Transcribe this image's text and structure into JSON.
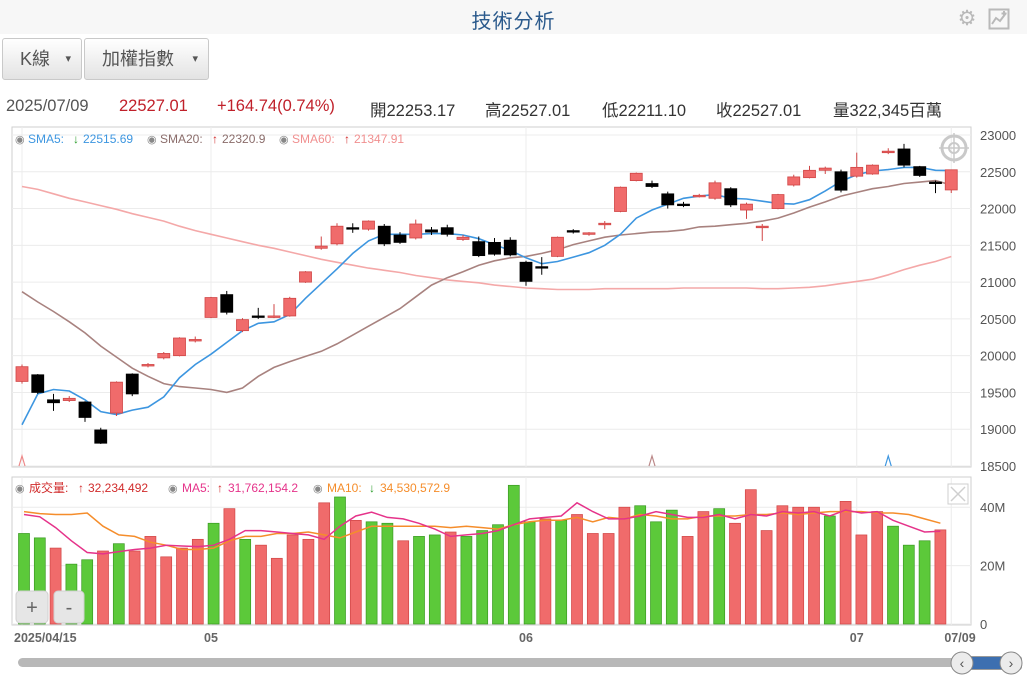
{
  "header": {
    "title": "技術分析",
    "settings_icon": "gear-icon",
    "chart_icon": "chart-icon"
  },
  "toolbar": {
    "type_label": "K線",
    "index_label": "加權指數"
  },
  "info": {
    "date": "2025/07/09",
    "close_price": "22527.01",
    "change": "+164.74(0.74%)",
    "open": "開22253.17",
    "high": "高22527.01",
    "low": "低22211.10",
    "close": "收22527.01",
    "volume": "量322,345百萬"
  },
  "legend_price": {
    "sma5_label": "SMA5:",
    "sma5_value": "22515.69",
    "sma5_arrow": "↓",
    "sma20_label": "SMA20:",
    "sma20_value": "22320.9",
    "sma20_arrow": "↑",
    "sma60_label": "SMA60:",
    "sma60_value": "21347.91",
    "sma60_arrow": "↑"
  },
  "legend_volume": {
    "vol_label": "成交量:",
    "vol_value": "32,234,492",
    "vol_arrow": "↑",
    "ma5_label": "MA5:",
    "ma5_value": "31,762,154.2",
    "ma5_arrow": "↑",
    "ma10_label": "MA10:",
    "ma10_value": "34,530,572.9",
    "ma10_arrow": "↓"
  },
  "zoom": {
    "in_label": "+",
    "out_label": "-"
  },
  "colors": {
    "up": "#f06b6b",
    "down": "#000000",
    "sma5": "#3d96e0",
    "sma20": "#a8827f",
    "sma60": "#f4a8a8",
    "vol_up": "#f06b6b",
    "vol_down": "#5cc93a",
    "ma5": "#e5338a",
    "ma10": "#f58d2b",
    "info_red": "#c0202a",
    "title": "#2b5a8c"
  },
  "chart_data": [
    {
      "type": "candlestick",
      "ylim": [
        18500,
        23000
      ],
      "y_ticks": [
        "23000",
        "22500",
        "22000",
        "21500",
        "21000",
        "20500",
        "20000",
        "19500",
        "19000",
        "18500"
      ],
      "x_labels": [
        "2025/04/15",
        "05",
        "06",
        "07",
        "07/09"
      ],
      "candles": [
        {
          "o": 19650,
          "h": 19880,
          "l": 19620,
          "c": 19850
        },
        {
          "o": 19740,
          "h": 19750,
          "l": 19480,
          "c": 19500
        },
        {
          "o": 19400,
          "h": 19480,
          "l": 19250,
          "c": 19360
        },
        {
          "o": 19390,
          "h": 19450,
          "l": 19370,
          "c": 19420
        },
        {
          "o": 19370,
          "h": 19380,
          "l": 19100,
          "c": 19160
        },
        {
          "o": 18990,
          "h": 19020,
          "l": 18800,
          "c": 18810
        },
        {
          "o": 19220,
          "h": 19650,
          "l": 19180,
          "c": 19640
        },
        {
          "o": 19750,
          "h": 19760,
          "l": 19450,
          "c": 19480
        },
        {
          "o": 19860,
          "h": 19900,
          "l": 19840,
          "c": 19880
        },
        {
          "o": 19970,
          "h": 20050,
          "l": 19950,
          "c": 20030
        },
        {
          "o": 20000,
          "h": 20250,
          "l": 19990,
          "c": 20240
        },
        {
          "o": 20200,
          "h": 20260,
          "l": 20180,
          "c": 20220
        },
        {
          "o": 20520,
          "h": 20800,
          "l": 20510,
          "c": 20790
        },
        {
          "o": 20830,
          "h": 20880,
          "l": 20560,
          "c": 20590
        },
        {
          "o": 20340,
          "h": 20510,
          "l": 20320,
          "c": 20490
        },
        {
          "o": 20540,
          "h": 20650,
          "l": 20500,
          "c": 20520
        },
        {
          "o": 20530,
          "h": 20700,
          "l": 20510,
          "c": 20540
        },
        {
          "o": 20540,
          "h": 20800,
          "l": 20530,
          "c": 20780
        },
        {
          "o": 21000,
          "h": 21150,
          "l": 20990,
          "c": 21140
        },
        {
          "o": 21460,
          "h": 21620,
          "l": 21440,
          "c": 21490
        },
        {
          "o": 21520,
          "h": 21800,
          "l": 21500,
          "c": 21760
        },
        {
          "o": 21740,
          "h": 21800,
          "l": 21670,
          "c": 21730
        },
        {
          "o": 21720,
          "h": 21840,
          "l": 21700,
          "c": 21830
        },
        {
          "o": 21760,
          "h": 21790,
          "l": 21490,
          "c": 21520
        },
        {
          "o": 21640,
          "h": 21680,
          "l": 21520,
          "c": 21540
        },
        {
          "o": 21600,
          "h": 21850,
          "l": 21580,
          "c": 21790
        },
        {
          "o": 21710,
          "h": 21750,
          "l": 21640,
          "c": 21680
        },
        {
          "o": 21740,
          "h": 21780,
          "l": 21620,
          "c": 21650
        },
        {
          "o": 21580,
          "h": 21640,
          "l": 21560,
          "c": 21610
        },
        {
          "o": 21550,
          "h": 21620,
          "l": 21340,
          "c": 21360
        },
        {
          "o": 21540,
          "h": 21600,
          "l": 21360,
          "c": 21380
        },
        {
          "o": 21570,
          "h": 21610,
          "l": 21350,
          "c": 21370
        },
        {
          "o": 21270,
          "h": 21290,
          "l": 20950,
          "c": 21010
        },
        {
          "o": 21210,
          "h": 21340,
          "l": 21100,
          "c": 21200
        },
        {
          "o": 21350,
          "h": 21620,
          "l": 21340,
          "c": 21610
        },
        {
          "o": 21700,
          "h": 21720,
          "l": 21660,
          "c": 21680
        },
        {
          "o": 21650,
          "h": 21680,
          "l": 21630,
          "c": 21670
        },
        {
          "o": 21790,
          "h": 21830,
          "l": 21720,
          "c": 21800
        },
        {
          "o": 21960,
          "h": 22300,
          "l": 21950,
          "c": 22290
        },
        {
          "o": 22380,
          "h": 22490,
          "l": 22370,
          "c": 22480
        },
        {
          "o": 22340,
          "h": 22380,
          "l": 22280,
          "c": 22300
        },
        {
          "o": 22200,
          "h": 22230,
          "l": 22000,
          "c": 22050
        },
        {
          "o": 22060,
          "h": 22090,
          "l": 22020,
          "c": 22050
        },
        {
          "o": 22160,
          "h": 22200,
          "l": 22150,
          "c": 22180
        },
        {
          "o": 22140,
          "h": 22380,
          "l": 22120,
          "c": 22350
        },
        {
          "o": 22270,
          "h": 22290,
          "l": 22020,
          "c": 22050
        },
        {
          "o": 21980,
          "h": 22080,
          "l": 21860,
          "c": 22060
        },
        {
          "o": 21740,
          "h": 21790,
          "l": 21560,
          "c": 21760
        },
        {
          "o": 22000,
          "h": 22200,
          "l": 21990,
          "c": 22190
        },
        {
          "o": 22320,
          "h": 22460,
          "l": 22300,
          "c": 22430
        },
        {
          "o": 22420,
          "h": 22580,
          "l": 22410,
          "c": 22520
        },
        {
          "o": 22520,
          "h": 22570,
          "l": 22470,
          "c": 22550
        },
        {
          "o": 22500,
          "h": 22530,
          "l": 22220,
          "c": 22250
        },
        {
          "o": 22440,
          "h": 22760,
          "l": 22420,
          "c": 22560
        },
        {
          "o": 22470,
          "h": 22600,
          "l": 22460,
          "c": 22590
        },
        {
          "o": 22760,
          "h": 22820,
          "l": 22740,
          "c": 22780
        },
        {
          "o": 22810,
          "h": 22880,
          "l": 22560,
          "c": 22590
        },
        {
          "o": 22570,
          "h": 22580,
          "l": 22430,
          "c": 22450
        },
        {
          "o": 22360,
          "h": 22380,
          "l": 22210,
          "c": 22350
        },
        {
          "o": 22253.17,
          "h": 22527.01,
          "l": 22211.1,
          "c": 22527.01
        }
      ],
      "sma5": [
        19060,
        19480,
        19540,
        19520,
        19400,
        19240,
        19200,
        19260,
        19300,
        19440,
        19700,
        19880,
        20020,
        20180,
        20340,
        20440,
        20460,
        20560,
        20780,
        20980,
        21180,
        21390,
        21560,
        21650,
        21650,
        21650,
        21660,
        21660,
        21640,
        21590,
        21510,
        21430,
        21330,
        21250,
        21280,
        21340,
        21400,
        21500,
        21650,
        21870,
        21980,
        22060,
        22140,
        22170,
        22190,
        22140,
        22130,
        22100,
        22070,
        22060,
        22120,
        22240,
        22370,
        22460,
        22510,
        22530,
        22560,
        22560,
        22520,
        22515.69
      ],
      "sma20": [
        20870,
        20730,
        20600,
        20460,
        20310,
        20130,
        19980,
        19830,
        19720,
        19620,
        19580,
        19560,
        19540,
        19500,
        19560,
        19720,
        19840,
        19920,
        19990,
        20060,
        20160,
        20280,
        20400,
        20520,
        20640,
        20800,
        20960,
        21060,
        21140,
        21230,
        21290,
        21330,
        21350,
        21390,
        21440,
        21510,
        21560,
        21610,
        21640,
        21660,
        21680,
        21690,
        21710,
        21750,
        21760,
        21780,
        21800,
        21830,
        21870,
        21940,
        22020,
        22090,
        22170,
        22220,
        22270,
        22300,
        22340,
        22360,
        22380,
        22320.9
      ],
      "sma60": [
        22300,
        22260,
        22200,
        22140,
        22090,
        22040,
        21990,
        21930,
        21880,
        21830,
        21760,
        21700,
        21650,
        21600,
        21550,
        21500,
        21460,
        21410,
        21360,
        21310,
        21270,
        21230,
        21190,
        21160,
        21130,
        21090,
        21060,
        21030,
        21010,
        20990,
        20960,
        20940,
        20920,
        20910,
        20900,
        20900,
        20900,
        20910,
        20910,
        20910,
        20910,
        20910,
        20920,
        20920,
        20920,
        20920,
        20920,
        20910,
        20910,
        20920,
        20930,
        20950,
        20980,
        21010,
        21040,
        21100,
        21170,
        21230,
        21280,
        21347.91
      ]
    },
    {
      "type": "bar",
      "ylim": [
        0,
        50000000
      ],
      "y_ticks": [
        "40M",
        "20M",
        "0"
      ],
      "volume": [
        31000000,
        29500000,
        26000000,
        20500000,
        22000000,
        25000000,
        27500000,
        25000000,
        30000000,
        23000000,
        26000000,
        29000000,
        34500000,
        39500000,
        29000000,
        27000000,
        22500000,
        30500000,
        29000000,
        41500000,
        43500000,
        35500000,
        35000000,
        34500000,
        28500000,
        30000000,
        30500000,
        31500000,
        30000000,
        32000000,
        34000000,
        47500000,
        35000000,
        36000000,
        35500000,
        37500000,
        31000000,
        31000000,
        40000000,
        40500000,
        35000000,
        39000000,
        30000000,
        38500000,
        39500000,
        34500000,
        46000000,
        32000000,
        40500000,
        40000000,
        40000000,
        37000000,
        42000000,
        30500000,
        38500000,
        33500000,
        27000000,
        28500000,
        32234492
      ],
      "ma5": [
        37500,
        36700,
        33000,
        28500,
        24500,
        24000,
        24800,
        25500,
        26000,
        27000,
        26700,
        26500,
        27000,
        29000,
        32000,
        32000,
        31500,
        31000,
        30500,
        29000,
        33500,
        37000,
        38300,
        36500,
        36000,
        34500,
        32500,
        30000,
        30500,
        31000,
        32000,
        34000,
        36000,
        36500,
        37000,
        41500,
        38500,
        36000,
        36000,
        37000,
        38500,
        37500,
        36500,
        36500,
        37500,
        36000,
        37500,
        37000,
        38500,
        38000,
        38500,
        37000,
        39000,
        38000,
        38500,
        35500,
        33500,
        31500,
        31762154.2
      ],
      "ma10": [
        38500,
        37800,
        37500,
        37500,
        38000,
        33500,
        30500,
        30000,
        28000,
        27000,
        25500,
        25500,
        26000,
        28500,
        30000,
        30000,
        31000,
        31000,
        31500,
        30500,
        29500,
        31500,
        33500,
        33500,
        33500,
        33500,
        33500,
        33000,
        33500,
        33000,
        32500,
        34000,
        35000,
        35500,
        35500,
        36500,
        35000,
        36500,
        36000,
        37500,
        37000,
        36000,
        36000,
        37000,
        37000,
        37000,
        37500,
        37500,
        38000,
        37500,
        38000,
        38500,
        38500,
        38500,
        38000,
        38000,
        37500,
        36000,
        34530572.9
      ]
    }
  ]
}
